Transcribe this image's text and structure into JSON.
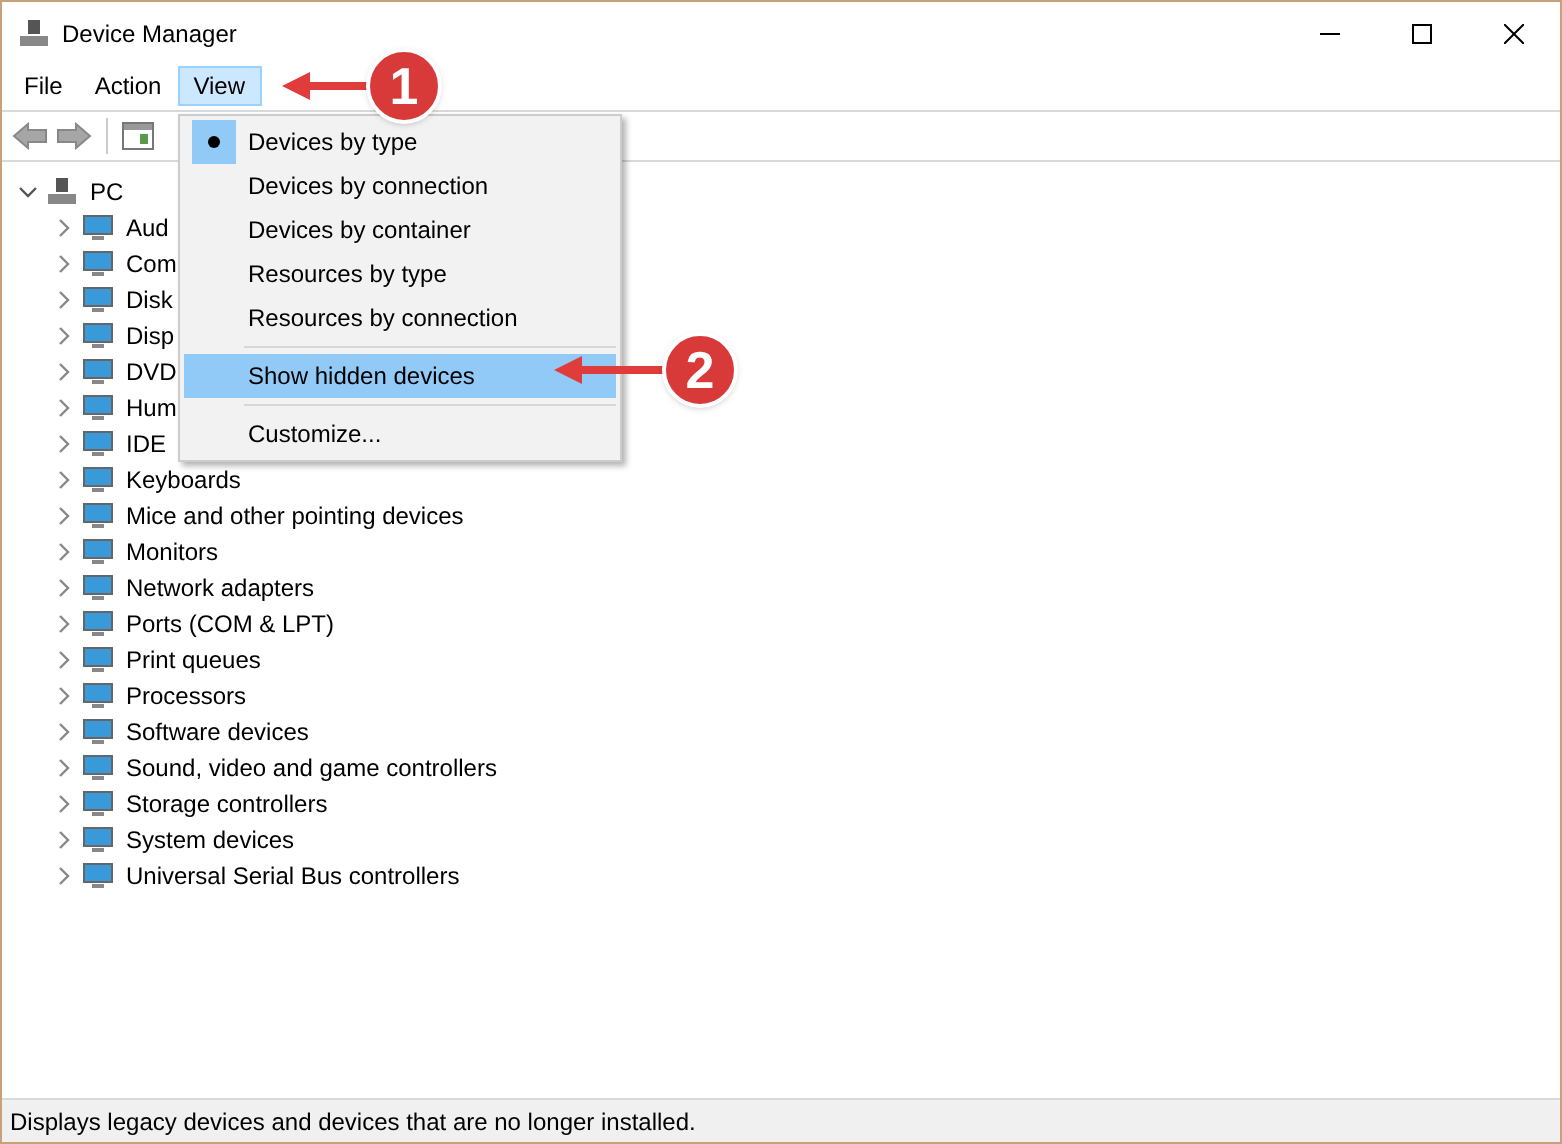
{
  "window": {
    "title": "Device Manager"
  },
  "menu_bar": [
    {
      "label": "File",
      "selected": false
    },
    {
      "label": "Action",
      "selected": false
    },
    {
      "label": "View",
      "selected": true
    }
  ],
  "tree": {
    "label": "PC",
    "expanded": true,
    "children": [
      {
        "label": "Aud",
        "expanded": false
      },
      {
        "label": "Com",
        "expanded": false
      },
      {
        "label": "Disk",
        "expanded": false
      },
      {
        "label": "Disp",
        "expanded": false
      },
      {
        "label": "DVD",
        "expanded": false
      },
      {
        "label": "Hum",
        "expanded": false
      },
      {
        "label": "IDE",
        "expanded": false
      },
      {
        "label": "Keyboards",
        "expanded": false
      },
      {
        "label": "Mice and other pointing devices",
        "expanded": false
      },
      {
        "label": "Monitors",
        "expanded": false
      },
      {
        "label": "Network adapters",
        "expanded": false
      },
      {
        "label": "Ports (COM & LPT)",
        "expanded": false
      },
      {
        "label": "Print queues",
        "expanded": false
      },
      {
        "label": "Processors",
        "expanded": false
      },
      {
        "label": "Software devices",
        "expanded": false
      },
      {
        "label": "Sound, video and game controllers",
        "expanded": false
      },
      {
        "label": "Storage controllers",
        "expanded": false
      },
      {
        "label": "System devices",
        "expanded": false
      },
      {
        "label": "Universal Serial Bus controllers",
        "expanded": false
      }
    ]
  },
  "view_menu": [
    {
      "label": "Devices by type",
      "checked": true,
      "selected": false
    },
    {
      "label": "Devices by connection",
      "checked": false,
      "selected": false
    },
    {
      "label": "Devices by container",
      "checked": false,
      "selected": false
    },
    {
      "label": "Resources by type",
      "checked": false,
      "selected": false
    },
    {
      "label": "Resources by connection",
      "checked": false,
      "selected": false,
      "separator_after": true
    },
    {
      "label": "Show hidden devices",
      "checked": false,
      "selected": true,
      "separator_after": true
    },
    {
      "label": "Customize...",
      "checked": false,
      "selected": false
    }
  ],
  "callouts": [
    {
      "number": "1"
    },
    {
      "number": "2"
    }
  ],
  "status_bar": "Displays legacy devices and devices that are no longer installed."
}
